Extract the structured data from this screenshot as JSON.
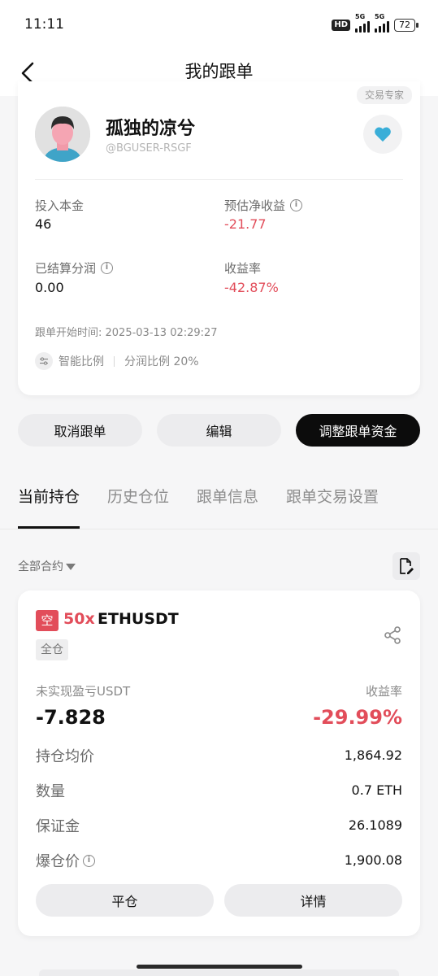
{
  "status_bar": {
    "time": "11:11",
    "hd": "HD",
    "net1": "5G",
    "net2": "5G",
    "battery": "72"
  },
  "header": {
    "title": "我的跟单"
  },
  "trader": {
    "tag": "交易专家",
    "name": "孤独的凉兮",
    "handle": "@BGUSER-RSGF",
    "stats": {
      "invested_label": "投入本金",
      "invested_value": "46",
      "est_net_label": "预估净收益",
      "est_net_value": "-21.77",
      "settled_label": "已结算分润",
      "settled_value": "0.00",
      "roi_label": "收益率",
      "roi_value": "-42.87%"
    },
    "start_time": "跟单开始时间:  2025-03-13 02:29:27",
    "mode": "智能比例",
    "profit_share": "分润比例 20%"
  },
  "actions": {
    "cancel": "取消跟单",
    "edit": "编辑",
    "adjust_funds": "调整跟单资金"
  },
  "tabs": [
    {
      "label": "当前持仓"
    },
    {
      "label": "历史仓位"
    },
    {
      "label": "跟单信息"
    },
    {
      "label": "跟单交易设置"
    }
  ],
  "filter": {
    "label": "全部合约"
  },
  "position": {
    "side": "空",
    "leverage": "50x",
    "symbol": "ETHUSDT",
    "margin_mode": "全仓",
    "pnl_label": "未实现盈亏USDT",
    "pnl_value": "-7.828",
    "roe_label": "收益率",
    "roe_value": "-29.99%",
    "rows": [
      {
        "label": "持仓均价",
        "value": "1,864.92"
      },
      {
        "label": "数量",
        "value": "0.7 ETH"
      },
      {
        "label": "保证金",
        "value": "26.1089"
      },
      {
        "label": "爆仓价",
        "value": "1,900.08"
      }
    ],
    "close_label": "平仓",
    "detail_label": "详情"
  },
  "colors": {
    "loss_red": "#e24d5a",
    "heart_blue": "#3aaed8",
    "primary_black": "#0c0c0c"
  }
}
